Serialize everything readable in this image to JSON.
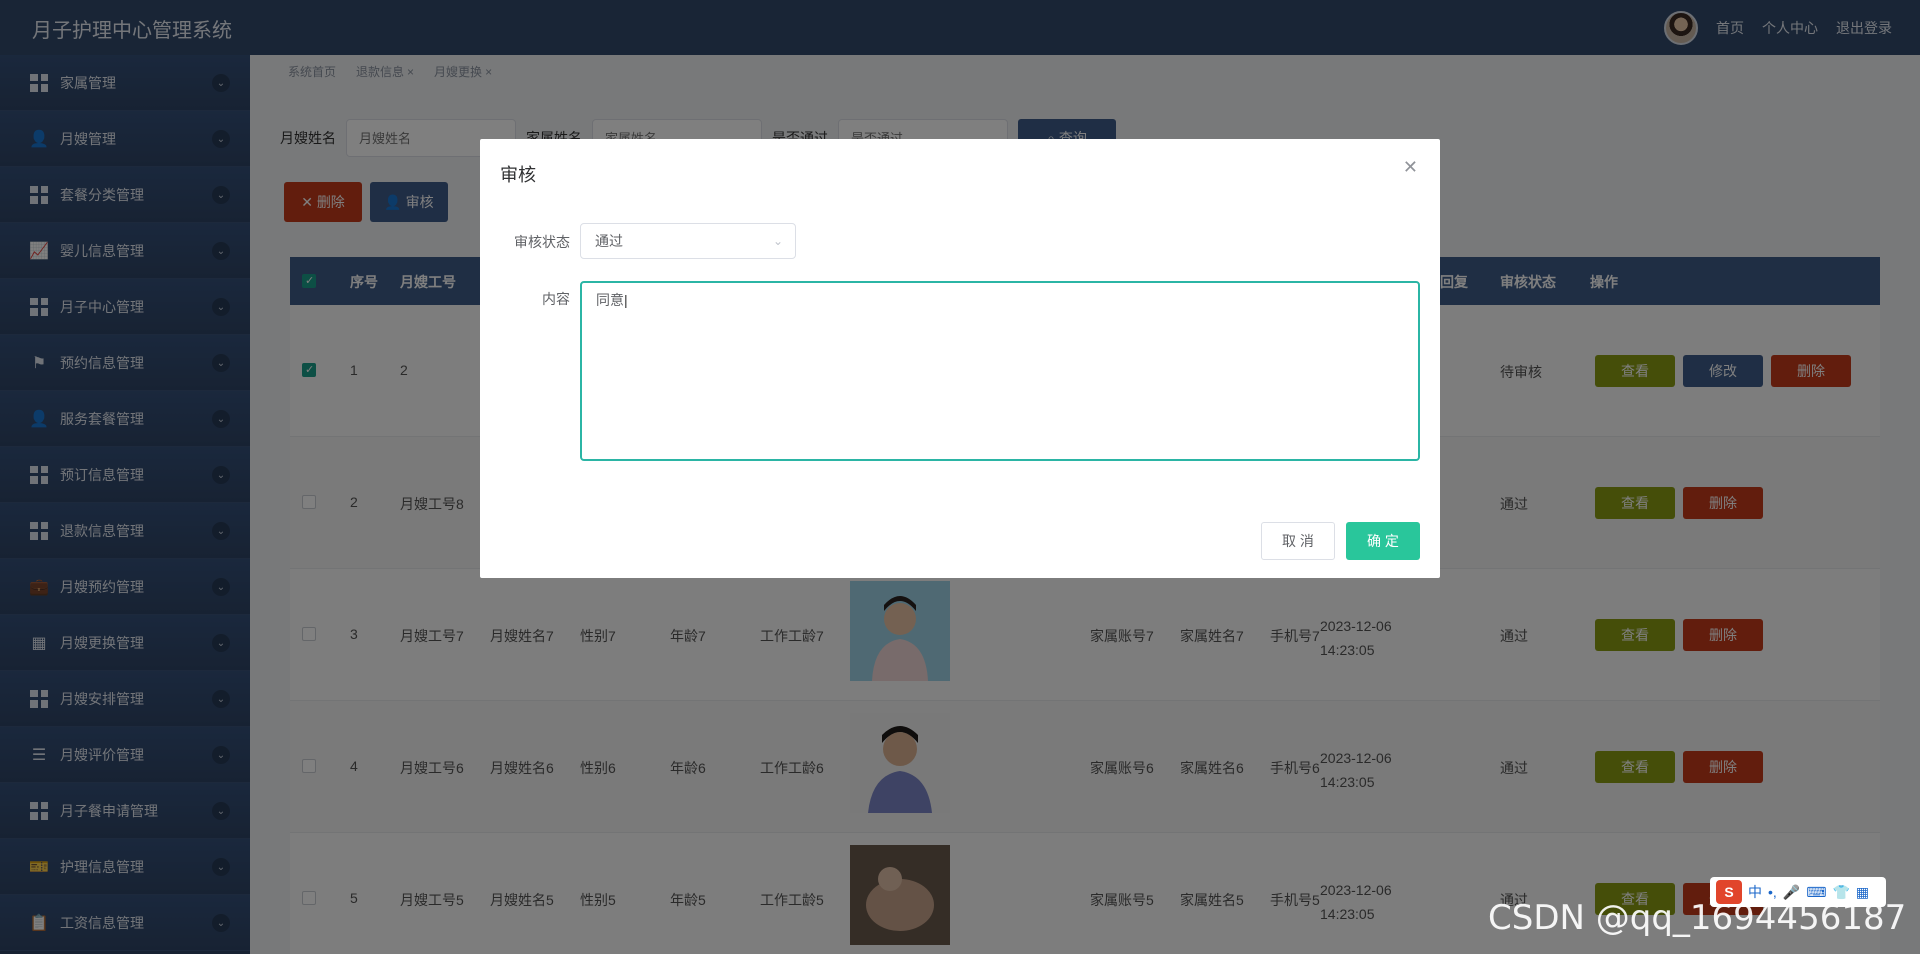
{
  "app": {
    "title": "月子护理中心管理系统"
  },
  "header": {
    "nav": [
      "首页",
      "个人中心",
      "退出登录"
    ]
  },
  "sidebar": {
    "items": [
      {
        "label": "家属管理",
        "icon": "grid-icon"
      },
      {
        "label": "月嫂管理",
        "icon": "user-icon"
      },
      {
        "label": "套餐分类管理",
        "icon": "grid-icon"
      },
      {
        "label": "婴儿信息管理",
        "icon": "chart-icon"
      },
      {
        "label": "月子中心管理",
        "icon": "grid-icon"
      },
      {
        "label": "预约信息管理",
        "icon": "flag-icon"
      },
      {
        "label": "服务套餐管理",
        "icon": "person-icon"
      },
      {
        "label": "预订信息管理",
        "icon": "grid-icon"
      },
      {
        "label": "退款信息管理",
        "icon": "grid-icon"
      },
      {
        "label": "月嫂预约管理",
        "icon": "briefcase-icon"
      },
      {
        "label": "月嫂更换管理",
        "icon": "apps-icon"
      },
      {
        "label": "月嫂安排管理",
        "icon": "grid-icon"
      },
      {
        "label": "月嫂评价管理",
        "icon": "sliders-icon"
      },
      {
        "label": "月子餐申请管理",
        "icon": "grid-icon"
      },
      {
        "label": "护理信息管理",
        "icon": "ticket-icon"
      },
      {
        "label": "工资信息管理",
        "icon": "clipboard-icon"
      }
    ]
  },
  "breadcrumb": {
    "items": [
      "系统首页",
      "退款信息",
      "月嫂更换"
    ]
  },
  "search": {
    "field1_label": "月嫂姓名",
    "field1_placeholder": "月嫂姓名",
    "field2_label": "家属姓名",
    "field2_placeholder": "家属姓名",
    "field3_label": "是否通过",
    "field3_placeholder": "是否通过",
    "query_label": "查询"
  },
  "actions": {
    "delete_label": "删除",
    "audit_label": "审核"
  },
  "table": {
    "headers": {
      "index": "序号",
      "worker_no": "月嫂工号",
      "reply": "回复",
      "status": "审核状态",
      "ops": "操作"
    },
    "rows": [
      {
        "index": "1",
        "worker_no": "2",
        "worker_name": "",
        "gender": "",
        "age": "",
        "years": "",
        "account": "",
        "family_name": "",
        "phone": "",
        "time": "",
        "status": "待审核",
        "checked": true
      },
      {
        "index": "2",
        "worker_no": "月嫂工号8",
        "worker_name": "",
        "gender": "",
        "age": "",
        "years": "",
        "account": "",
        "family_name": "",
        "phone": "",
        "time": "",
        "status": "通过",
        "checked": false
      },
      {
        "index": "3",
        "worker_no": "月嫂工号7",
        "worker_name": "月嫂姓名7",
        "gender": "性别7",
        "age": "年龄7",
        "years": "工作工龄7",
        "account": "家属账号7",
        "family_name": "家属姓名7",
        "phone": "手机号7",
        "time": "2023-12-06 14:23:05",
        "status": "通过",
        "checked": false
      },
      {
        "index": "4",
        "worker_no": "月嫂工号6",
        "worker_name": "月嫂姓名6",
        "gender": "性别6",
        "age": "年龄6",
        "years": "工作工龄6",
        "account": "家属账号6",
        "family_name": "家属姓名6",
        "phone": "手机号6",
        "time": "2023-12-06 14:23:05",
        "status": "通过",
        "checked": false
      },
      {
        "index": "5",
        "worker_no": "月嫂工号5",
        "worker_name": "月嫂姓名5",
        "gender": "性别5",
        "age": "年龄5",
        "years": "工作工龄5",
        "account": "家属账号5",
        "family_name": "家属姓名5",
        "phone": "手机号5",
        "time": "2023-12-06 14:23:05",
        "status": "通过",
        "checked": false
      }
    ],
    "row_buttons": {
      "view": "查看",
      "edit": "修改",
      "delete": "删除"
    }
  },
  "modal": {
    "title": "审核",
    "status_label": "审核状态",
    "status_value": "通过",
    "content_label": "内容",
    "content_value": "同意",
    "cancel_label": "取 消",
    "ok_label": "确 定"
  },
  "ime": {
    "logo": "S",
    "mode": "中"
  },
  "watermark": "CSDN @qq_1694456187",
  "colors": {
    "header": "#324a6c",
    "sidebar": "#2f4565",
    "accent": "#29c69b",
    "danger": "#c53a1b",
    "view": "#8b9d13"
  }
}
